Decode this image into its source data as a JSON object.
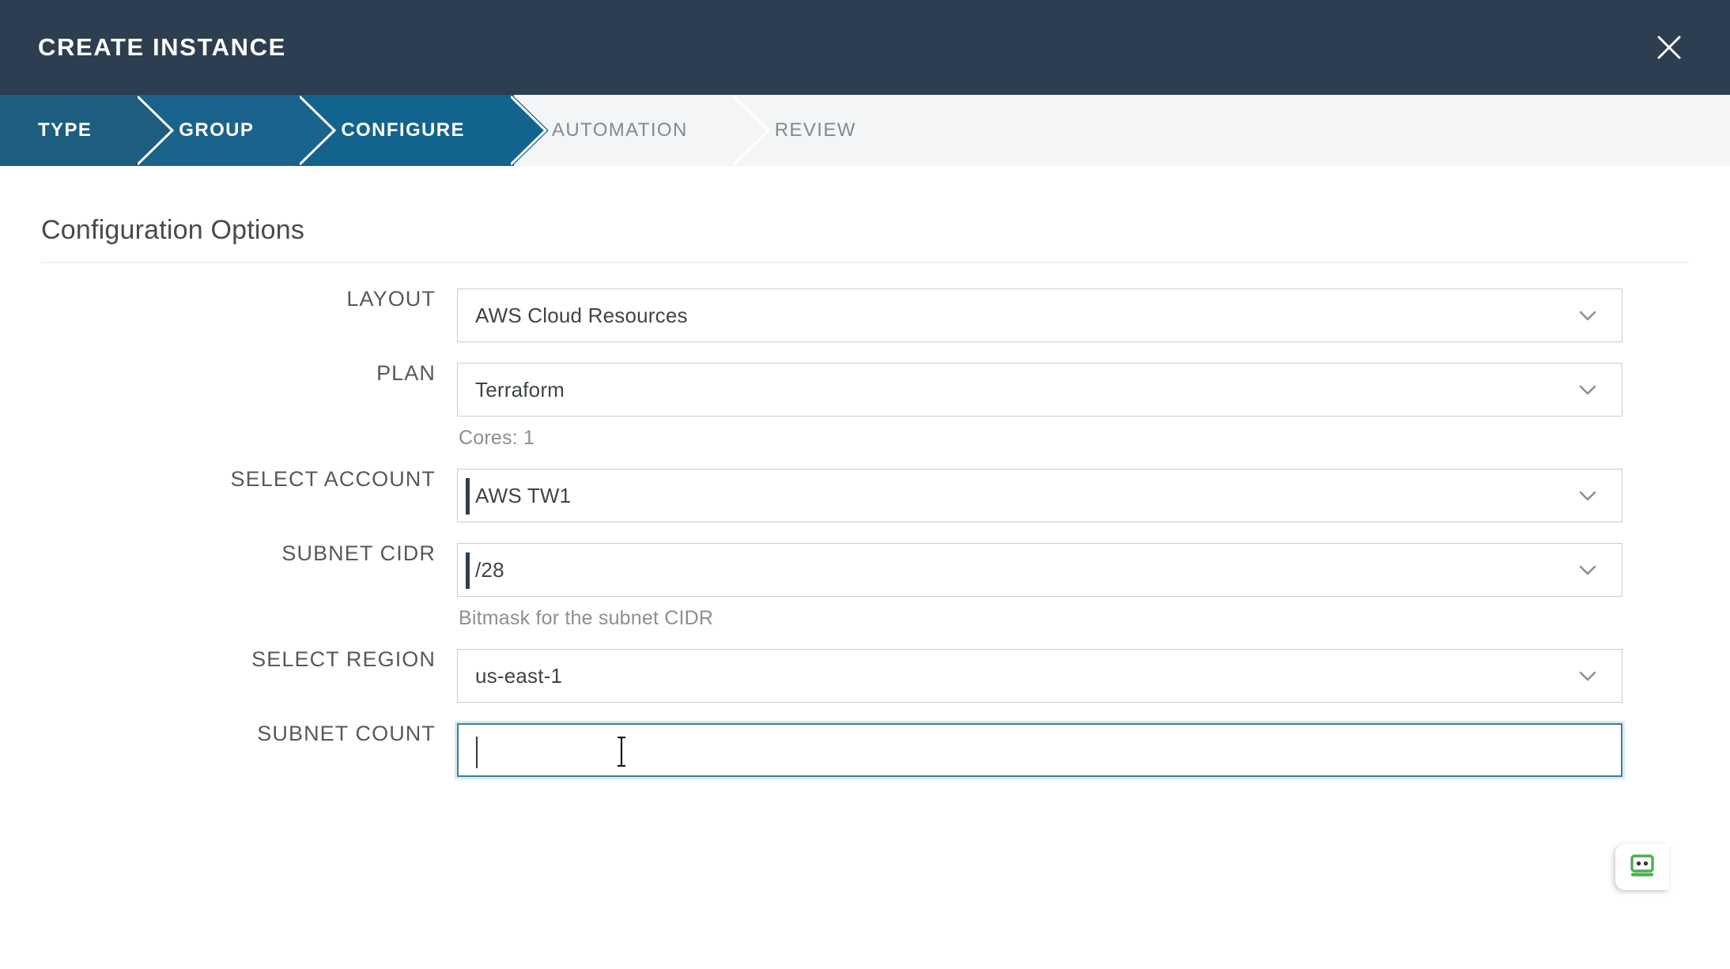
{
  "window": {
    "title": "CREATE INSTANCE",
    "close_icon": "close-icon",
    "titlebar_bg": "#2c3e50"
  },
  "stepper": {
    "steps": [
      {
        "label": "TYPE",
        "state": "completed"
      },
      {
        "label": "GROUP",
        "state": "completed"
      },
      {
        "label": "CONFIGURE",
        "state": "active"
      },
      {
        "label": "AUTOMATION",
        "state": "upcoming"
      },
      {
        "label": "REVIEW",
        "state": "upcoming"
      }
    ],
    "active_color": "#12648f",
    "completed_color": "#1d5d80",
    "upcoming_color": "#7f8c8d",
    "track_bg": "#f4f5f6"
  },
  "section": {
    "heading": "Configuration Options"
  },
  "fields": [
    {
      "label": "LAYOUT",
      "value": "AWS Cloud Resources",
      "type": "select",
      "icon": "chevron-down-icon",
      "hint": "",
      "focused": false,
      "caret": false
    },
    {
      "label": "PLAN",
      "value": "Terraform",
      "type": "select",
      "icon": "chevron-down-icon",
      "hint": "Cores: 1",
      "focused": false,
      "caret": false
    },
    {
      "label": "SELECT ACCOUNT",
      "value": "AWS TW1",
      "type": "select",
      "icon": "chevron-down-icon",
      "hint": "",
      "focused": false,
      "caret": true
    },
    {
      "label": "SUBNET CIDR",
      "value": "/28",
      "type": "select",
      "icon": "chevron-down-icon",
      "hint": "Bitmask for the subnet CIDR",
      "focused": false,
      "caret": true
    },
    {
      "label": "SELECT REGION",
      "value": "us-east-1",
      "type": "select",
      "icon": "chevron-down-icon",
      "hint": "",
      "focused": false,
      "caret": false
    },
    {
      "label": "SUBNET COUNT",
      "value": "",
      "type": "text",
      "icon": "",
      "hint": "",
      "focused": true,
      "caret": true
    }
  ],
  "widget": {
    "name": "roboform-icon",
    "accent": "#4caf50"
  }
}
